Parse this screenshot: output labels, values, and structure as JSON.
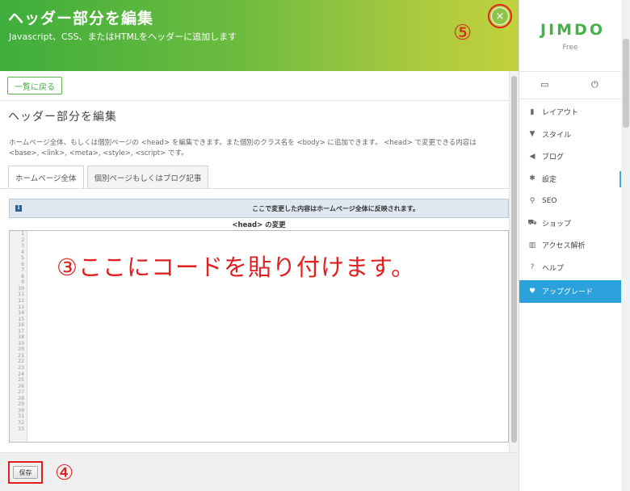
{
  "header": {
    "title": "ヘッダー部分を編集",
    "subtitle": "Javascript、CSS、またはHTMLをヘッダーに追加します",
    "close_glyph": "×"
  },
  "back_button": "一覧に戻る",
  "page_title": "ヘッダー部分を編集",
  "description": "ホームページ全体、もしくは個別ページの <head> を編集できます。また個別のクラス名を <body> に追加できます。 <head> で変更できる内容は <base>, <link>, <meta>, <style>, <script> です。",
  "tabs": [
    {
      "label": "ホームページ全体",
      "active": true
    },
    {
      "label": "個別ページもしくはブログ記事",
      "active": false
    }
  ],
  "notice": {
    "icon": "i",
    "text": "ここで変更した内容はホームページ全体に反映されます。"
  },
  "code_label": "<head> の変更",
  "line_numbers": [
    "1",
    "2",
    "3",
    "4",
    "5",
    "6",
    "7",
    "8",
    "9",
    "10",
    "11",
    "12",
    "13",
    "14",
    "15",
    "16",
    "17",
    "18",
    "19",
    "20",
    "21",
    "22",
    "23",
    "24",
    "25",
    "26",
    "27",
    "28",
    "29",
    "30",
    "31",
    "32",
    "33"
  ],
  "annotations": {
    "paste_here": "③ここにコードを貼り付けます。",
    "save_marker": "④",
    "close_marker": "⑤"
  },
  "save_button": "保存",
  "sidebar": {
    "logo": "JIMDO",
    "plan": "Free",
    "toolbar": [
      {
        "icon": "monitor-icon",
        "glyph": "▭"
      },
      {
        "icon": "power-icon",
        "glyph": "⏻"
      }
    ],
    "items": [
      {
        "label": "レイアウト",
        "icon": "layout-icon",
        "glyph": "▮"
      },
      {
        "label": "スタイル",
        "icon": "brush-icon",
        "glyph": "▼"
      },
      {
        "label": "ブログ",
        "icon": "megaphone-icon",
        "glyph": "◀"
      },
      {
        "label": "設定",
        "icon": "gear-icon",
        "glyph": "✱",
        "active": true
      },
      {
        "label": "SEO",
        "icon": "search-icon",
        "glyph": "⚲"
      },
      {
        "label": "ショップ",
        "icon": "cart-icon",
        "glyph": "⛟"
      },
      {
        "label": "アクセス解析",
        "icon": "chart-icon",
        "glyph": "▥"
      },
      {
        "label": "ヘルプ",
        "icon": "help-icon",
        "glyph": "?"
      },
      {
        "label": "アップグレード",
        "icon": "heart-icon",
        "glyph": "♥",
        "upgrade": true
      }
    ]
  },
  "colors": {
    "header_start": "#3fae3b",
    "header_end": "#c2d23c",
    "annotation_red": "#e02020",
    "jimdo_green": "#47b04b",
    "upgrade_blue": "#2ba1dc"
  }
}
